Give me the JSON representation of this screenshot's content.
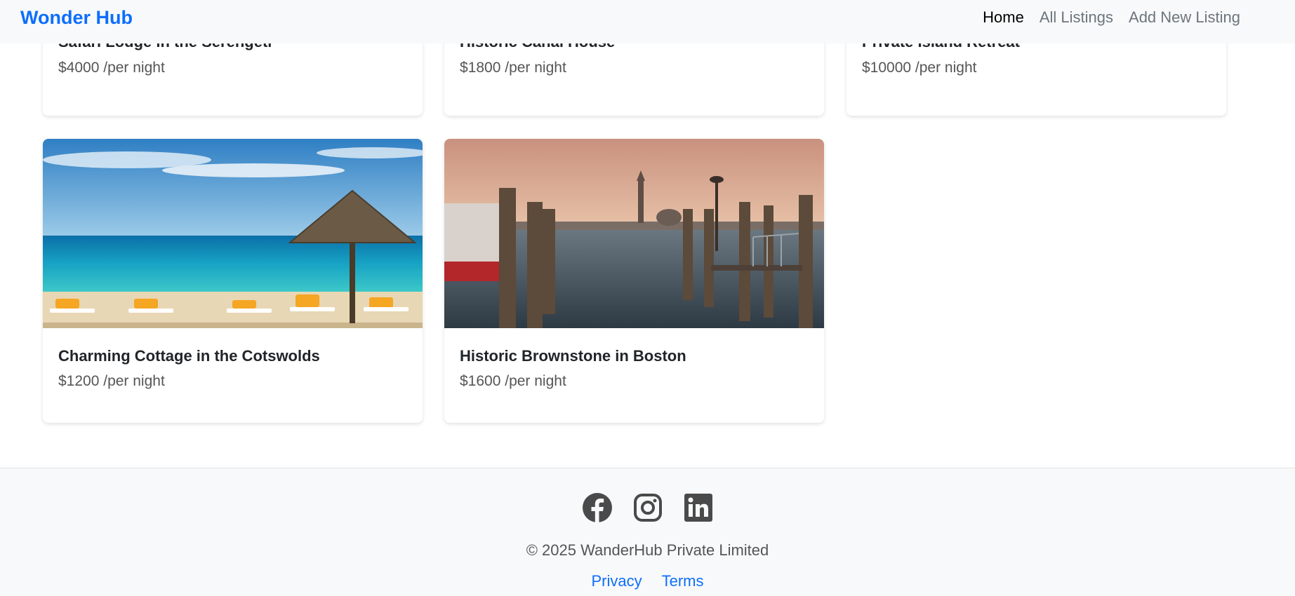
{
  "navbar": {
    "brand": "Wonder Hub",
    "links": [
      {
        "label": "Home",
        "active": true
      },
      {
        "label": "All Listings",
        "active": false
      },
      {
        "label": "Add New Listing",
        "active": false
      }
    ]
  },
  "listings": [
    {
      "title": "Safari Lodge in the Serengeti",
      "price": "$4000 /per night"
    },
    {
      "title": "Historic Canal House",
      "price": "$1800 /per night"
    },
    {
      "title": "Private Island Retreat",
      "price": "$10000 /per night"
    },
    {
      "title": "Charming Cottage in the Cotswolds",
      "price": "$1200 /per night",
      "image": "beach-with-thatched-umbrella"
    },
    {
      "title": "Historic Brownstone in Boston",
      "price": "$1600 /per night",
      "image": "venice-lagoon-pier-at-sunset"
    }
  ],
  "footer": {
    "social_icons": [
      "facebook-icon",
      "instagram-icon",
      "linkedin-icon"
    ],
    "copyright": "© 2025 WanderHub Private Limited",
    "links": [
      "Privacy",
      "Terms"
    ]
  },
  "colors": {
    "brand": "#0d6efd",
    "nav_bg": "#f8f9fa",
    "link": "#0d6efd"
  }
}
